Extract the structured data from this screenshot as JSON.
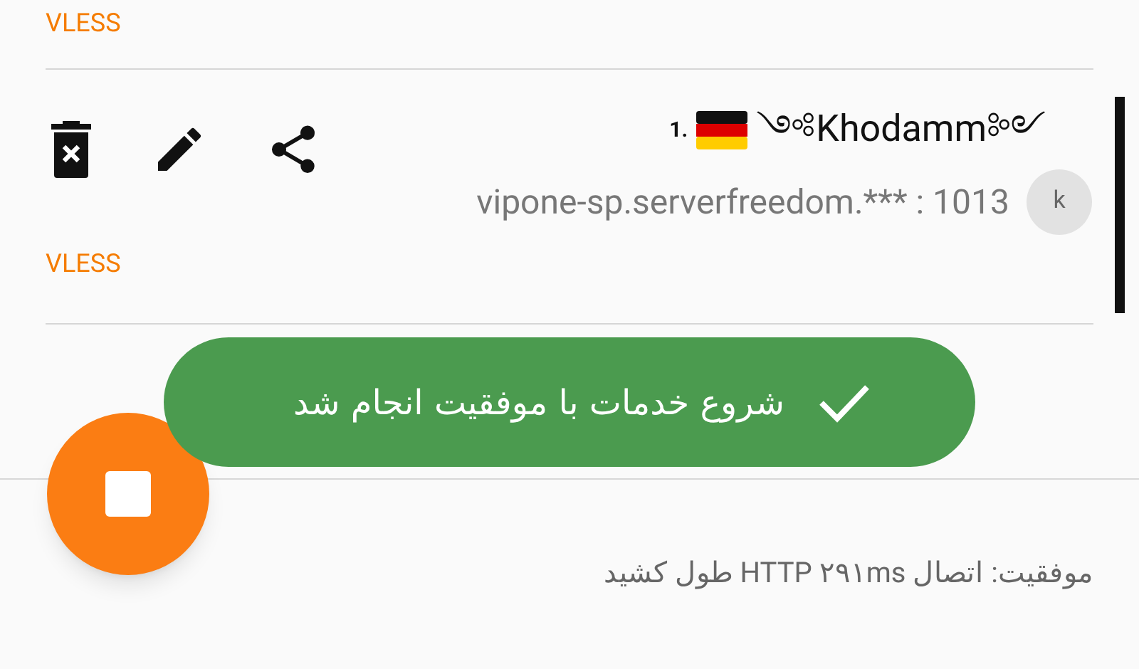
{
  "top_item": {
    "protocol": "VLESS"
  },
  "server": {
    "index": "1.",
    "name": "༺Khodamm༻",
    "address": "vipone-sp.serverfreedom.*** : 1013",
    "avatar": "k",
    "protocol": "VLESS",
    "selected": true
  },
  "toast": {
    "message": "شروع خدمات با موفقیت انجام شد"
  },
  "fab": {
    "running": true
  },
  "status": {
    "text": "موفقیت: اتصال HTTP ۲۹۱ms طول کشید"
  }
}
